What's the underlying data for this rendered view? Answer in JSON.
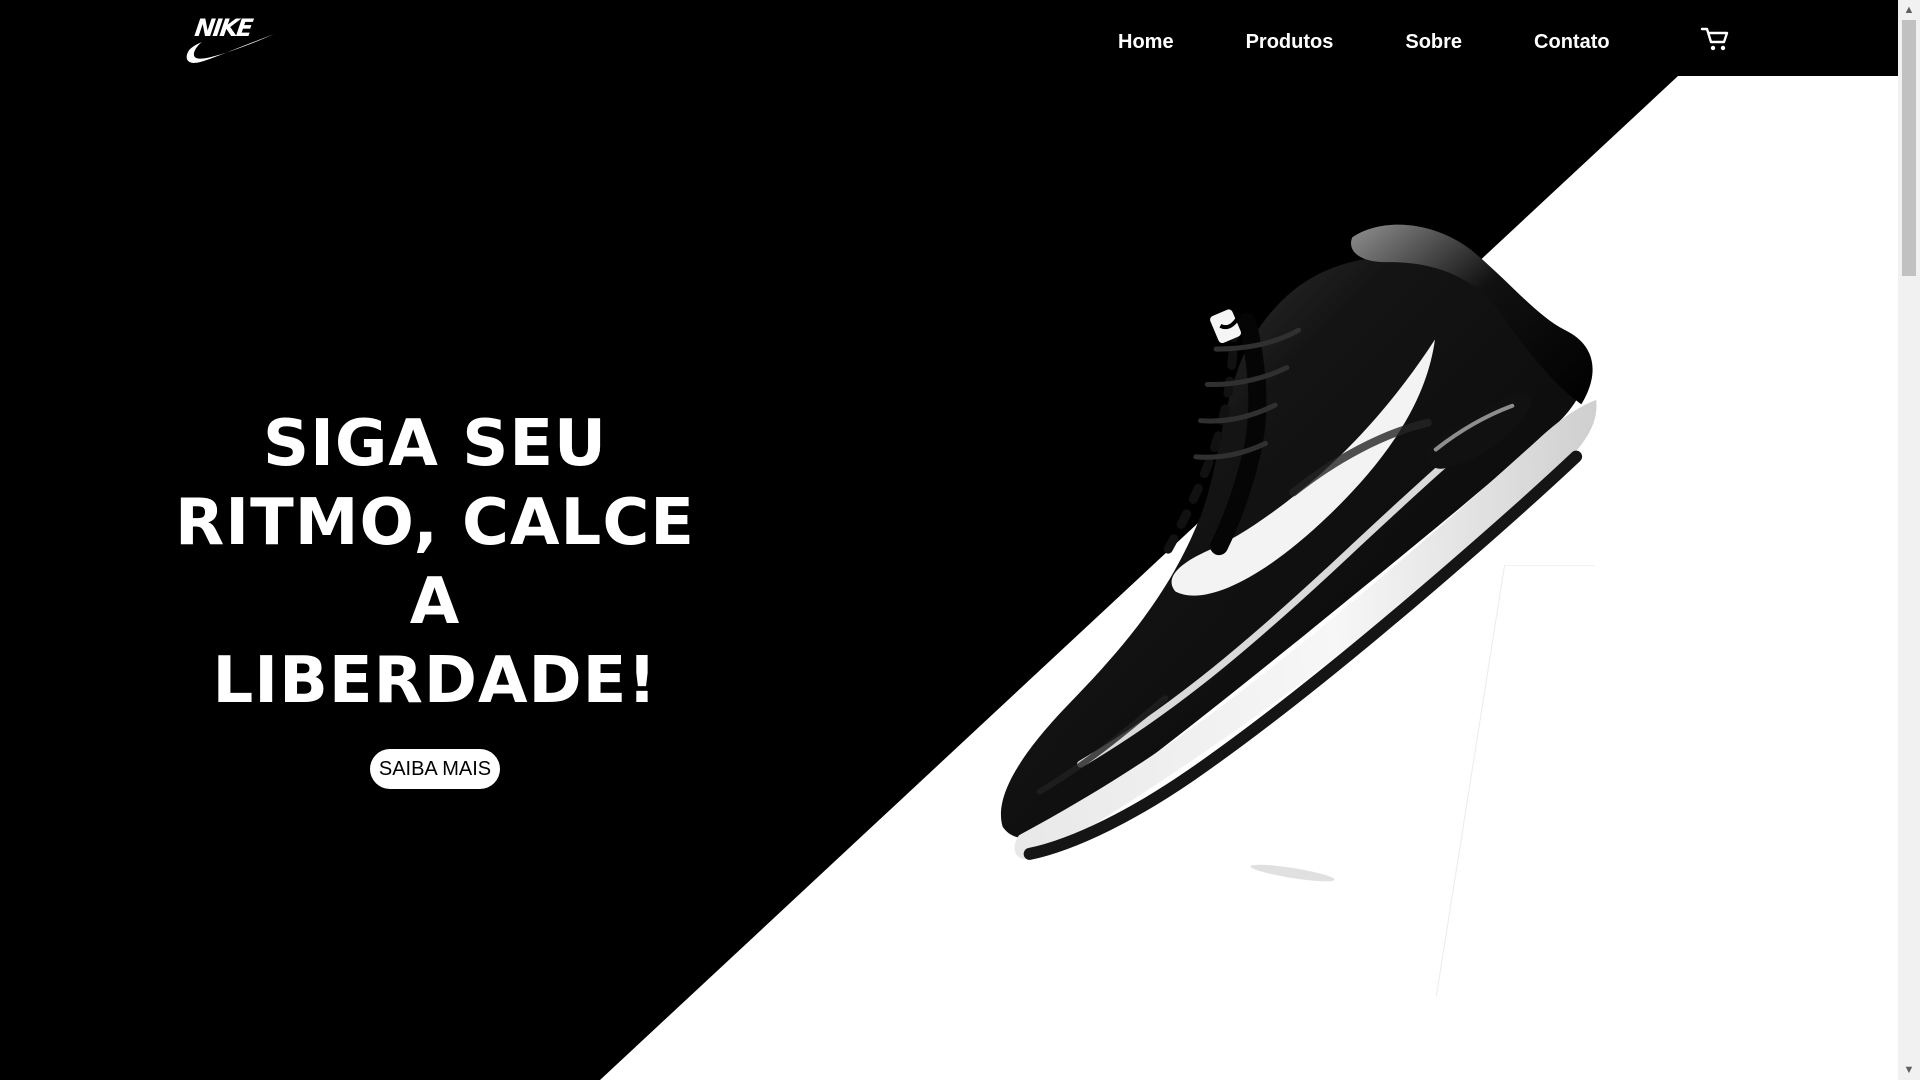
{
  "brand": {
    "logo_text": "NIKE"
  },
  "nav": {
    "items": [
      {
        "label": "Home"
      },
      {
        "label": "Produtos"
      },
      {
        "label": "Sobre"
      },
      {
        "label": "Contato"
      }
    ],
    "cart_icon": "cart-icon"
  },
  "hero": {
    "headline_lines": [
      "SIGA SEU",
      "RITMO, CALCE A",
      "LIBERDADE!"
    ],
    "button_label": "SAIBA MAIS",
    "product_image": "black-and-white-running-shoe"
  },
  "colors": {
    "primary_black": "#000000",
    "primary_white": "#ffffff",
    "scrollbar_track": "#f1f1f1",
    "scrollbar_thumb": "#c1c1c1"
  },
  "scrollbar": {
    "up_icon": "scroll-up-icon",
    "down_icon": "scroll-down-icon"
  }
}
